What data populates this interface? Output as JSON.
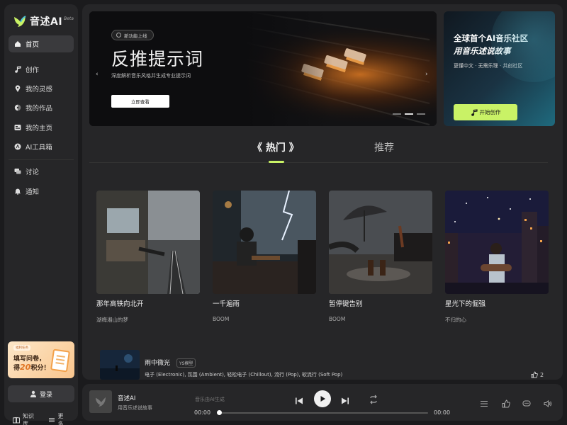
{
  "app": {
    "logo_text": "音述AI",
    "beta_label": "Beta"
  },
  "sidebar": {
    "items": [
      {
        "label": "首页",
        "icon": "home-icon",
        "active": true
      },
      {
        "label": "创作",
        "icon": "music-note-icon"
      },
      {
        "label": "我的灵感",
        "icon": "location-pin-icon"
      },
      {
        "label": "我的作品",
        "icon": "disc-icon"
      },
      {
        "label": "我的主页",
        "icon": "profile-card-icon"
      },
      {
        "label": "AI工具箱",
        "icon": "ai-toolbox-icon"
      },
      {
        "label": "讨论",
        "icon": "chat-icon"
      },
      {
        "label": "通知",
        "icon": "bell-icon"
      }
    ],
    "promo": {
      "tag": "福利任务",
      "line1": "填写问卷，",
      "line2_prefix": "得",
      "line2_number": "20",
      "line2_suffix": "积分！"
    },
    "login_label": "登录",
    "footer": [
      {
        "label": "知识库",
        "icon": "book-icon"
      },
      {
        "label": "更多",
        "icon": "menu-icon"
      }
    ]
  },
  "banner": {
    "badge": "新功能上线",
    "title": "反推提示词",
    "subtitle": "深度解析音乐风格并生成专业提示词",
    "button": "立即查看",
    "slide_count": 3,
    "active_slide": 2
  },
  "community": {
    "title_line1": "全球首个AI音乐社区",
    "title_line2": "用音乐述说故事",
    "subtitle": "更懂中文 · 无需乐理 · 共创社区",
    "button": "开始创作"
  },
  "tabs": {
    "hot": "《 热门 》",
    "recommend": "推荐",
    "active": "hot"
  },
  "cards": [
    {
      "title": "那年高铁向北开",
      "artist": "湖梅湘山的梦"
    },
    {
      "title": "一千遍雨",
      "artist": "BOOM"
    },
    {
      "title": "暂停键告别",
      "artist": "BOOM"
    },
    {
      "title": "星光下的倔强",
      "artist": "不归的心"
    }
  ],
  "song_list": [
    {
      "title": "雨中微光",
      "model_tag": "YS模型",
      "genres": "电子 (Electronic), 氛围 (Ambient), 轻松电子 (Chillout), 流行 (Pop), 软流行 (Soft Pop)",
      "likes": "2"
    }
  ],
  "player": {
    "title": "音述AI",
    "subtitle": "用音乐述说故事",
    "ai_hint": "音乐由AI生成",
    "current_time": "00:00",
    "total_time": "00:00",
    "progress": 0
  },
  "colors": {
    "accent": "#c9f266",
    "background": "#1b1b1d",
    "panel": "#262628"
  }
}
